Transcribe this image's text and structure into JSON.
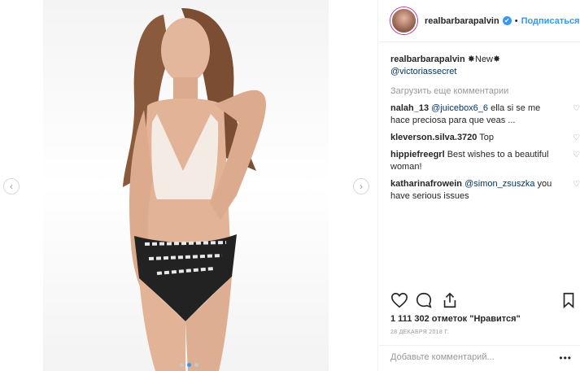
{
  "post": {
    "username": "realbarbarapalvin",
    "follow_label": "Подписаться",
    "verified_mark": "✔",
    "separator": "•",
    "media": {
      "prev_icon": "‹",
      "next_icon": "›",
      "slides": 3,
      "active_slide": 2
    },
    "caption": {
      "user": "realbarbarapalvin",
      "text": "✸New✸",
      "mention": "@victoriassecret"
    },
    "load_more_label": "Загрузить еще комментарии",
    "comments": [
      {
        "user": "nalah_13",
        "mention": "@juicebox6_6",
        "text": "ella si se me hace preciosa para que veas ..."
      },
      {
        "user": "kleverson.silva.3720",
        "mention": "",
        "text": "Top"
      },
      {
        "user": "hippiefreegrl",
        "mention": "",
        "text": "Best wishes to a beautiful woman!"
      },
      {
        "user": "katharinafrowein",
        "mention": "@simon_zsuszka",
        "text": "you have serious issues"
      }
    ],
    "likes_text": "1 111 302 отметок \"Нравится\"",
    "date_text": "28 ДЕКАБРЯ 2018 Г.",
    "comment_placeholder": "Добавьте комментарий...",
    "more_label": "•••",
    "icons": {
      "like": "heart-outline-icon",
      "comment": "comment-bubble-icon",
      "share": "share-icon",
      "save": "bookmark-icon"
    },
    "colors": {
      "accent": "#3897f0",
      "text": "#262626",
      "muted": "#999999",
      "link": "#003569"
    }
  }
}
